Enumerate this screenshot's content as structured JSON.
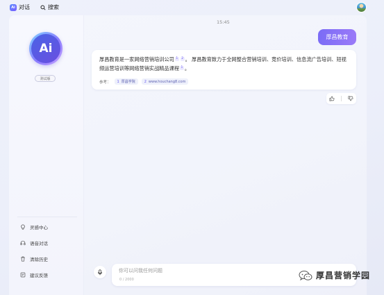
{
  "header": {
    "brand_label": "对话",
    "search_label": "搜索",
    "brand_logo_text": "Ai"
  },
  "sidebar": {
    "avatar_text": "Ai",
    "version_badge": "测试版",
    "menu": [
      {
        "label": "灵感中心",
        "icon": "bulb-icon"
      },
      {
        "label": "语音对话",
        "icon": "headset-icon"
      },
      {
        "label": "清除历史",
        "icon": "trash-icon"
      },
      {
        "label": "建议反馈",
        "icon": "feedback-icon"
      }
    ]
  },
  "chat": {
    "timestamp": "15:45",
    "user_message": "厚昌教育",
    "ai_reply": {
      "segment_1": "厚昌教育是一家网络营销培训公司",
      "segment_2": "。 厚昌教育致力于全网整合营销培训、竞价培训、信息流广告培训、短视频运营培训等网络营销实战精品课程",
      "segment_3": "。",
      "cites_1": [
        "1",
        "2"
      ],
      "cites_2": [
        "1"
      ]
    },
    "refs_label": "参考：",
    "refs": [
      {
        "num": "1",
        "label": "厚昌学院"
      },
      {
        "num": "2",
        "label": "www.houchang8.com"
      }
    ]
  },
  "input": {
    "placeholder": "你可以问我任何问题",
    "char_count": "0 / 2000"
  },
  "watermark": {
    "text": "厚昌营销学园"
  },
  "colors": {
    "accent": "#7b6cf6",
    "background": "#eceffa"
  }
}
